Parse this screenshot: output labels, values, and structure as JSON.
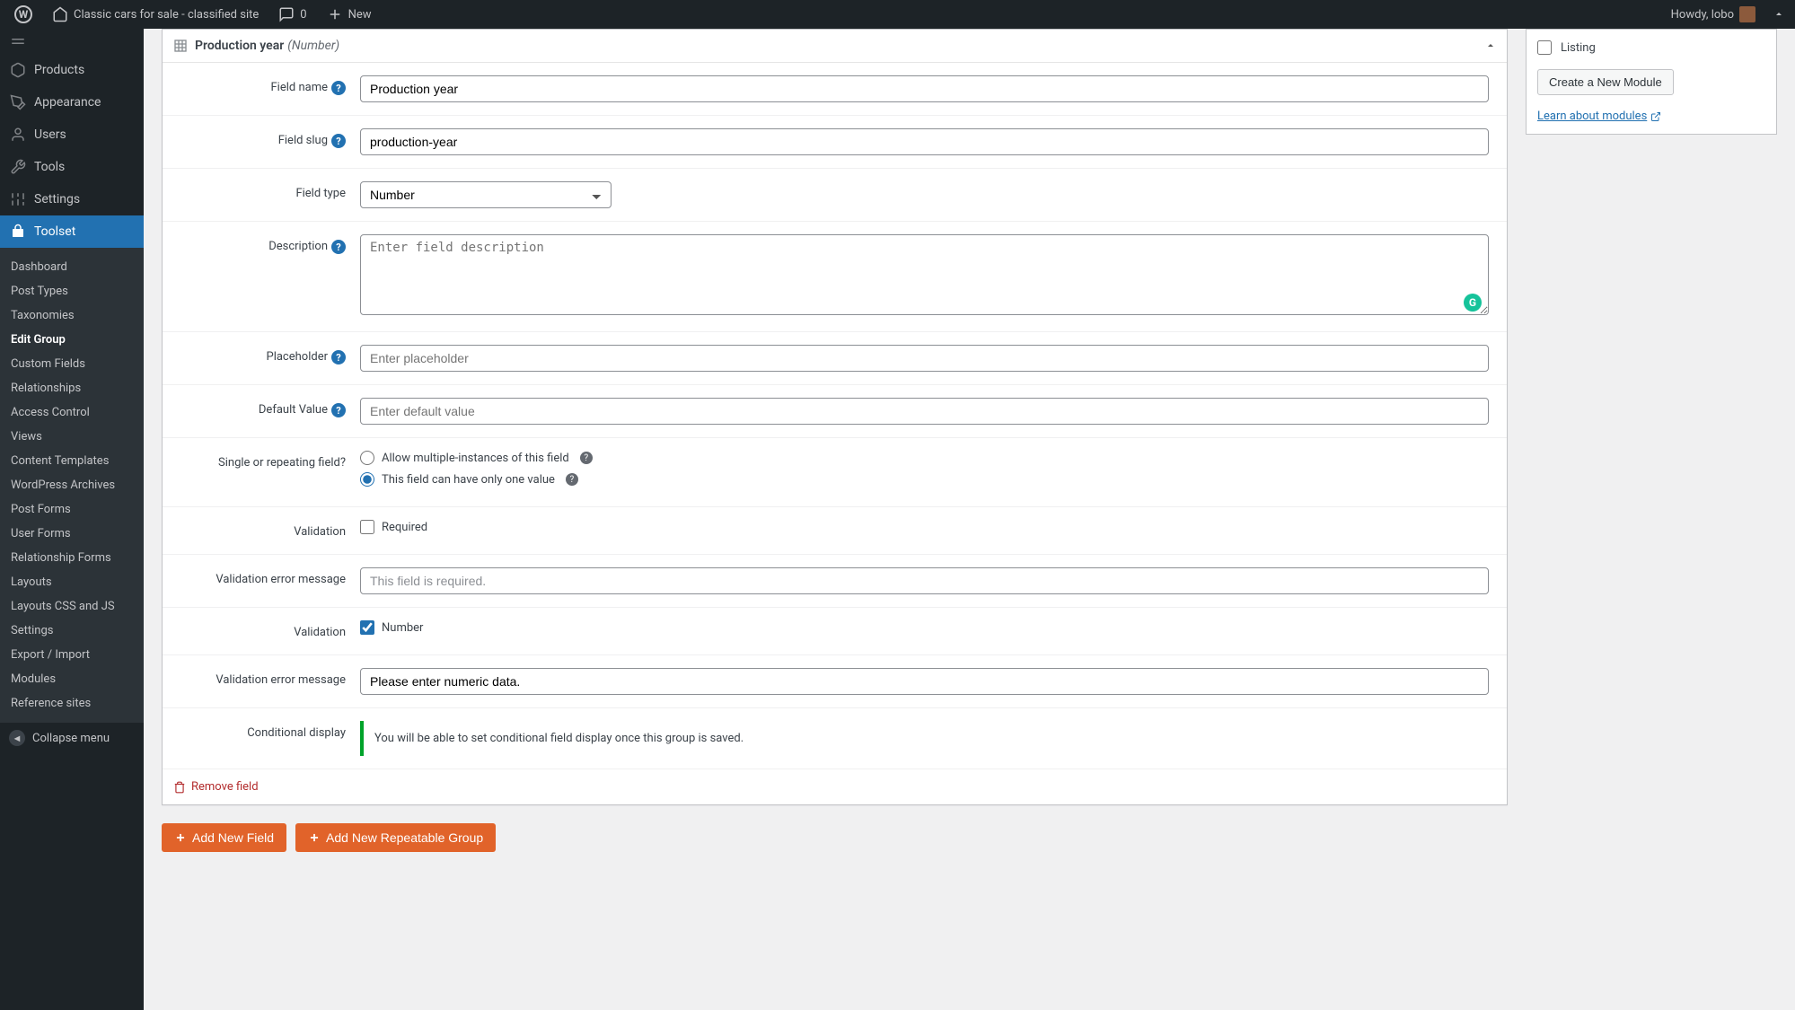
{
  "adminbar": {
    "site_name": "Classic cars for sale - classified site",
    "comments": "0",
    "new_label": "New",
    "howdy": "Howdy, lobo"
  },
  "sidebar": {
    "items": [
      {
        "label": "Products"
      },
      {
        "label": "Appearance"
      },
      {
        "label": "Users"
      },
      {
        "label": "Tools"
      },
      {
        "label": "Settings"
      },
      {
        "label": "Toolset"
      }
    ],
    "submenu": [
      "Dashboard",
      "Post Types",
      "Taxonomies",
      "Edit Group",
      "Custom Fields",
      "Relationships",
      "Access Control",
      "Views",
      "Content Templates",
      "WordPress Archives",
      "Post Forms",
      "User Forms",
      "Relationship Forms",
      "Layouts",
      "Layouts CSS and JS",
      "Settings",
      "Export / Import",
      "Modules",
      "Reference sites"
    ],
    "collapse": "Collapse menu"
  },
  "field_box": {
    "title": "Production year",
    "type": "(Number)",
    "rows": {
      "field_name_label": "Field name",
      "field_name_value": "Production year",
      "field_slug_label": "Field slug",
      "field_slug_value": "production-year",
      "field_type_label": "Field type",
      "field_type_value": "Number",
      "description_label": "Description",
      "description_placeholder": "Enter field description",
      "placeholder_label": "Placeholder",
      "placeholder_placeholder": "Enter placeholder",
      "default_label": "Default Value",
      "default_placeholder": "Enter default value",
      "single_label": "Single or repeating field?",
      "single_opt1": "Allow multiple-instances of this field",
      "single_opt2": "This field can have only one value",
      "validation1_label": "Validation",
      "validation1_opt": "Required",
      "verr1_label": "Validation error message",
      "verr1_value": "This field is required.",
      "validation2_label": "Validation",
      "validation2_opt": "Number",
      "verr2_label": "Validation error message",
      "verr2_value": "Please enter numeric data.",
      "cond_label": "Conditional display",
      "cond_notice": "You will be able to set conditional field display once this group is saved."
    },
    "remove": "Remove field"
  },
  "actions": {
    "add_field": "Add New Field",
    "add_group": "Add New Repeatable Group"
  },
  "modules": {
    "listing": "Listing",
    "create": "Create a New Module",
    "learn": "Learn about modules"
  }
}
